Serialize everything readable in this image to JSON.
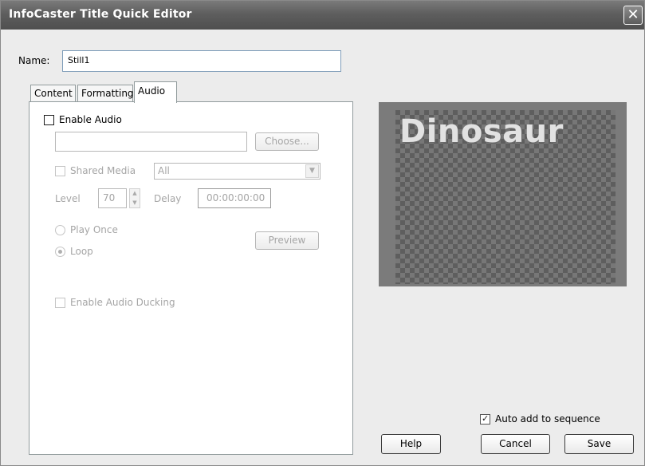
{
  "window": {
    "title": "InfoCaster Title Quick Editor",
    "close_glyph": "✕"
  },
  "name_field": {
    "label": "Name:",
    "value": "Still1"
  },
  "tabs": [
    {
      "label": "Content",
      "active": false
    },
    {
      "label": "Formatting",
      "active": false
    },
    {
      "label": "Audio",
      "active": true
    }
  ],
  "audio": {
    "enable_audio": {
      "label": "Enable Audio",
      "checked": false
    },
    "file_path": "",
    "choose_label": "Choose...",
    "shared_media": {
      "label": "Shared Media",
      "checked": false
    },
    "media_select": {
      "value": "All"
    },
    "level": {
      "label": "Level",
      "value": "70"
    },
    "delay": {
      "label": "Delay",
      "value": "00:00:00:00"
    },
    "play_once": {
      "label": "Play Once",
      "selected": false
    },
    "loop": {
      "label": "Loop",
      "selected": true
    },
    "preview_label": "Preview",
    "ducking": {
      "label": "Enable Audio Ducking",
      "checked": false
    }
  },
  "preview_image": {
    "text": "Dinosaur"
  },
  "footer": {
    "auto_add": {
      "label": "Auto add to sequence",
      "checked": true
    },
    "help_label": "Help",
    "cancel_label": "Cancel",
    "save_label": "Save"
  }
}
